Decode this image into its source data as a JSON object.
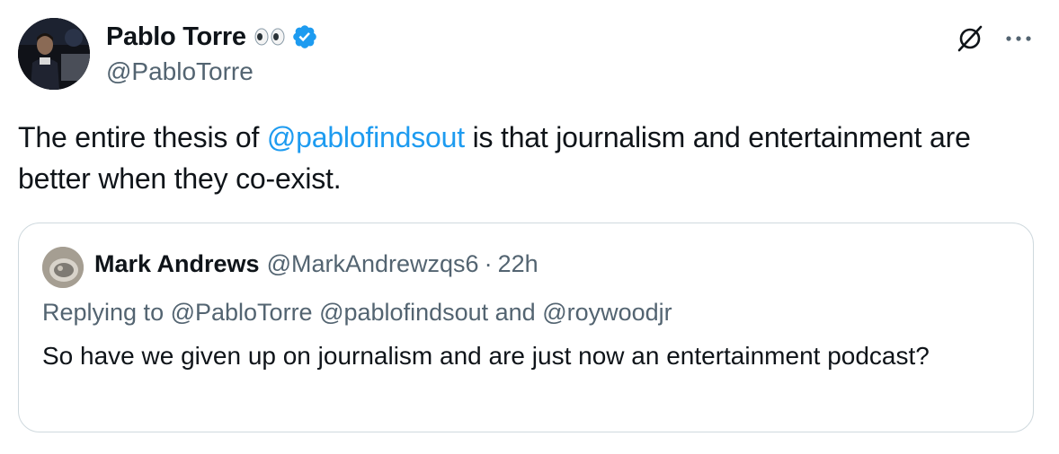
{
  "tweet": {
    "author": {
      "display_name": "Pablo Torre",
      "handle": "@PabloTorre",
      "emoji": "eyes-emoji",
      "verified_icon": "verified-badge-icon",
      "verified_color": "#1d9bf0"
    },
    "text_before": "The entire thesis of ",
    "mention": "@pablofindsout",
    "text_after": " is that journalism and entertainment are better when they co-exist.",
    "actions": {
      "grok_icon": "grok-icon",
      "more_icon": "more-dots-icon"
    }
  },
  "quote": {
    "author": {
      "display_name": "Mark Andrews",
      "handle": "@MarkAndrewzqs6",
      "separator": "·",
      "time": "22h"
    },
    "reply_prefix": "Replying to ",
    "reply_to_1": "@PabloTorre",
    "reply_to_2": "@pablofindsout",
    "reply_and": " and ",
    "reply_to_3": "@roywoodjr",
    "text": "So have we given up on journalism and are just now an entertainment podcast?"
  },
  "colors": {
    "text_primary": "#0f1419",
    "text_secondary": "#536471",
    "link": "#1d9bf0",
    "border": "#cfd9de"
  }
}
